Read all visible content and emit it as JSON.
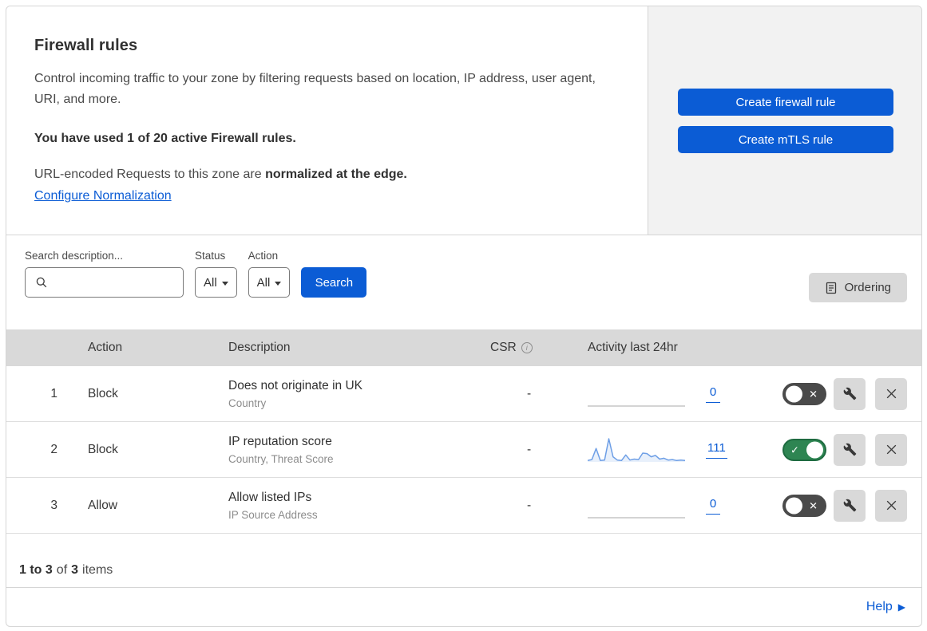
{
  "header": {
    "title": "Firewall rules",
    "description": "Control incoming traffic to your zone by filtering requests based on location, IP address, user agent, URI, and more.",
    "usage_notice": "You have used 1 of 20 active Firewall rules.",
    "normalization_prefix": "URL-encoded Requests to this zone are ",
    "normalization_bold": "normalized at the edge.",
    "normalization_link": "Configure Normalization"
  },
  "actions_panel": {
    "create_firewall_label": "Create firewall rule",
    "create_mtls_label": "Create mTLS rule"
  },
  "filters": {
    "search_label": "Search description...",
    "status_label": "Status",
    "status_value": "All",
    "action_label": "Action",
    "action_value": "All",
    "search_button_label": "Search",
    "ordering_button_label": "Ordering"
  },
  "table": {
    "columns": {
      "action": "Action",
      "description": "Description",
      "csr": "CSR",
      "activity": "Activity last 24hr"
    }
  },
  "rules": [
    {
      "id": "1",
      "action": "Block",
      "description": "Does not originate in UK",
      "fields": "Country",
      "csr": "-",
      "activity_count": "0",
      "sparkline": [],
      "enabled": false
    },
    {
      "id": "2",
      "action": "Block",
      "description": "IP reputation score",
      "fields": "Country, Threat Score",
      "csr": "-",
      "activity_count": "111",
      "sparkline": [
        6,
        10,
        58,
        6,
        8,
        100,
        22,
        8,
        6,
        30,
        8,
        12,
        10,
        38,
        36,
        22,
        28,
        12,
        16,
        8,
        10,
        6,
        8,
        6
      ],
      "enabled": true
    },
    {
      "id": "3",
      "action": "Allow",
      "description": "Allow listed IPs",
      "fields": "IP Source Address",
      "csr": "-",
      "activity_count": "0",
      "sparkline": [],
      "enabled": false
    }
  ],
  "footer": {
    "range": "1 to 3",
    "of_label": "of",
    "total": "3",
    "items_label": "items",
    "help_label": "Help"
  },
  "icons": {
    "check": "✓",
    "close": "✕",
    "info": "i",
    "help_arrow": "▶"
  },
  "colors": {
    "accent": "#0b5cd5",
    "toggle_on": "#2e8552",
    "toggle_off": "#4a4a4a",
    "spark": "#6e9fe6",
    "panel_gray": "#f2f2f2"
  }
}
